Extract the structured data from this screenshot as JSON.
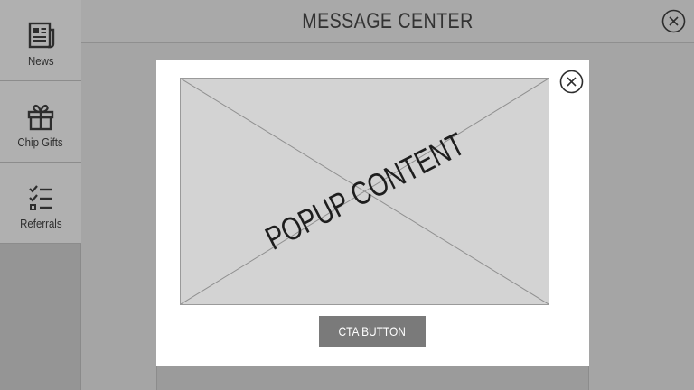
{
  "sidebar": {
    "items": [
      {
        "label": "News",
        "icon": "newspaper-icon"
      },
      {
        "label": "Chip Gifts",
        "icon": "gift-icon"
      },
      {
        "label": "Referrals",
        "icon": "checklist-icon"
      }
    ]
  },
  "header": {
    "title": "MESSAGE CENTER",
    "close_icon": "close-icon"
  },
  "popup": {
    "content_label": "POPUP CONTENT",
    "cta_label": "CTA BUTTON",
    "close_icon": "close-icon"
  },
  "colors": {
    "background": "#a5a5a5",
    "sidebar_item": "#b0b0b0",
    "popup": "#ffffff",
    "placeholder": "#d3d3d3",
    "cta": "#7a7a7a"
  }
}
